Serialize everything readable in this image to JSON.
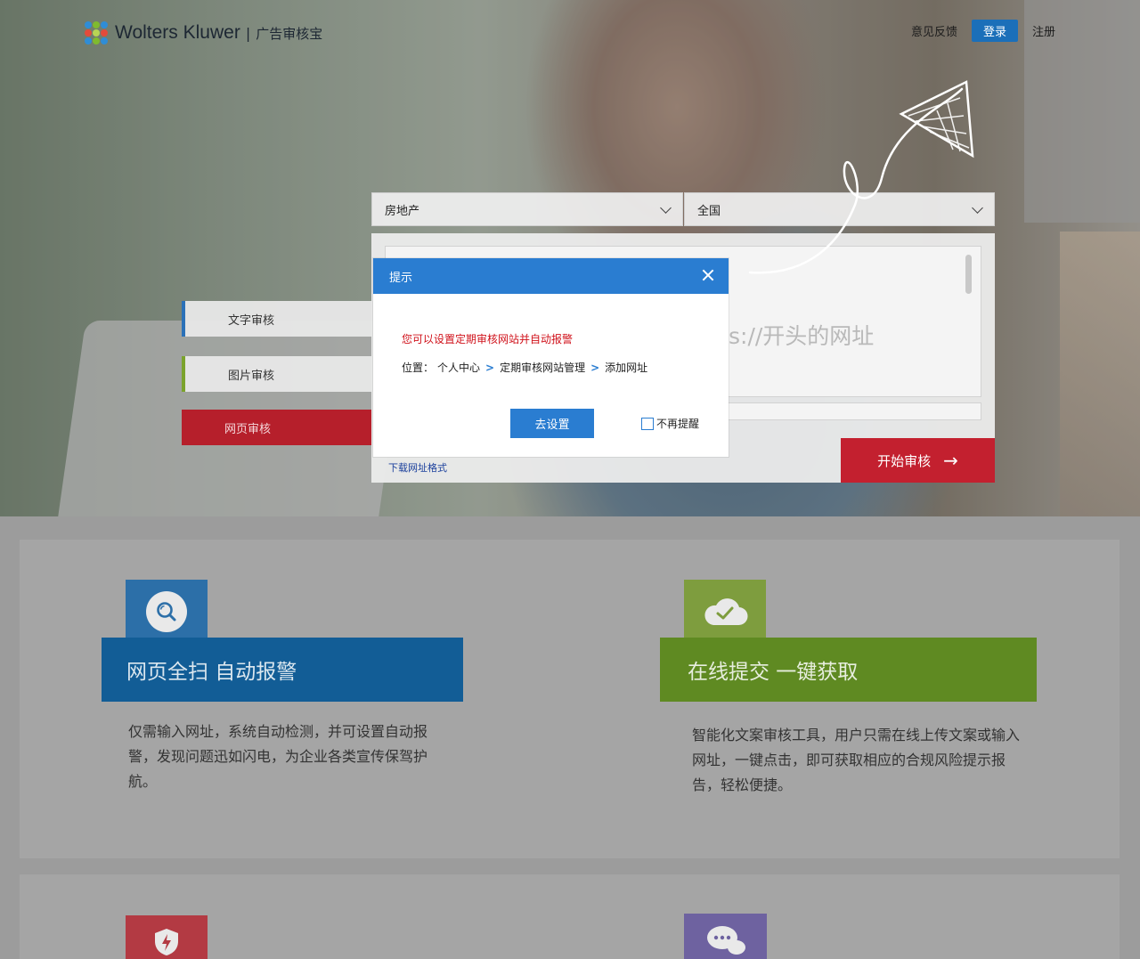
{
  "header": {
    "brand": "Wolters Kluwer",
    "brand_separator": "|",
    "product": "广告审核宝",
    "nav": {
      "feedback": "意见反馈",
      "login": "登录",
      "register": "注册"
    }
  },
  "search": {
    "industry_select": "房地产",
    "region_select": "全国",
    "url_placeholder": "以http://或https://开头的网址",
    "download_link": "下载网址格式",
    "start_button": "开始审核"
  },
  "side_tabs": {
    "text": "文字审核",
    "image": "图片审核",
    "web": "网页审核"
  },
  "modal": {
    "title": "提示",
    "tip": "您可以设置定期审核网站并自动报警",
    "location_label": "位置：",
    "crumbs": [
      "个人中心",
      "定期审核网站管理",
      "添加网址"
    ],
    "crumb_sep": ">",
    "go_button": "去设置",
    "dont_remind": "不再提醒"
  },
  "features": [
    {
      "title": "网页全扫 自动报警",
      "desc": "仅需输入网址，系统自动检测，并可设置自动报警，发现问题迅如闪电，为企业各类宣传保驾护航。",
      "icon": "search-icon",
      "color": "#125d96"
    },
    {
      "title": "在线提交 一键获取",
      "desc": "智能化文案审核工具，用户只需在线上传文案或输入网址，一键点击，即可获取相应的合规风险提示报告，轻松便捷。",
      "icon": "cloud-check-icon",
      "color": "#5f8a22"
    }
  ],
  "features_more": [
    {
      "icon": "shield-bolt-icon",
      "color": "#b33a43"
    },
    {
      "icon": "chat-bubble-icon",
      "color": "#6e62a0"
    }
  ],
  "colors": {
    "primary_blue": "#2a7dd1",
    "accent_red": "#c3202f",
    "tip_red": "#d0121b"
  }
}
